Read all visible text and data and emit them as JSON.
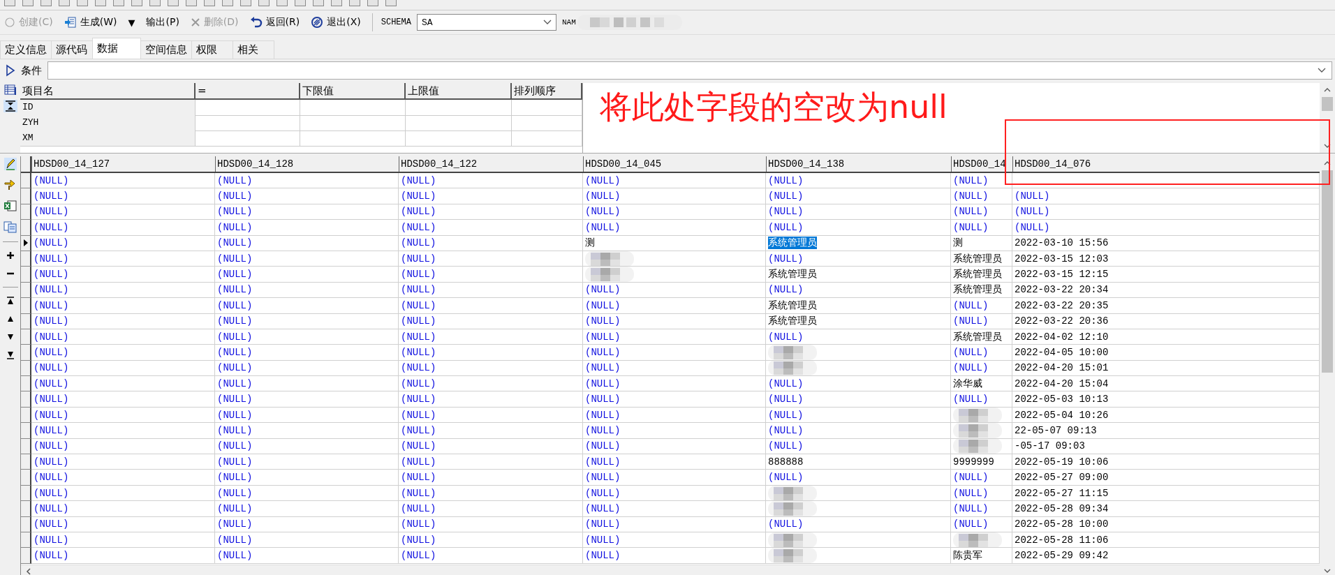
{
  "toolbar": {
    "buttons": [
      {
        "kind": "button",
        "label": "创建(C)",
        "disabled": true
      },
      {
        "kind": "button",
        "label": "生成(W)",
        "disabled": false
      },
      {
        "kind": "glyph",
        "label": "▼"
      },
      {
        "kind": "button",
        "label": "输出(P)",
        "disabled": false
      },
      {
        "kind": "button",
        "label": "删除(D)",
        "disabled": true
      },
      {
        "kind": "button",
        "label": "返回(R)",
        "disabled": false
      },
      {
        "kind": "button",
        "label": "退出(X)",
        "disabled": false
      }
    ]
  },
  "schema": {
    "label": "SCHEMA",
    "value": "SA"
  },
  "name_field": {
    "label": "NAM"
  },
  "tabs": [
    {
      "label": "定义信息",
      "selected": false
    },
    {
      "label": "源代码",
      "selected": false
    },
    {
      "label": "数据",
      "selected": true
    },
    {
      "label": "空间信息",
      "selected": false
    },
    {
      "label": "权限",
      "selected": false
    },
    {
      "label": "相关",
      "selected": false
    }
  ],
  "condition": {
    "label": "条件"
  },
  "filter": {
    "columns": [
      "项目名",
      "=",
      "下限值",
      "上限值",
      "排列顺序"
    ],
    "rows": [
      "ID",
      "ZYH",
      "XM"
    ]
  },
  "annotation": {
    "text": "将此处字段的空改为null"
  },
  "grid": {
    "columns": [
      "HDSD00_14_127",
      "HDSD00_14_128",
      "HDSD00_14_122",
      "HDSD00_14_045",
      "HDSD00_14_138",
      "HDSD00_14",
      "HDSD00_14_076"
    ],
    "rows": [
      {
        "current": false,
        "cells": [
          {
            "kind": "null",
            "value": "(NULL)"
          },
          {
            "kind": "null",
            "value": "(NULL)"
          },
          {
            "kind": "null",
            "value": "(NULL)"
          },
          {
            "kind": "null",
            "value": "(NULL)"
          },
          {
            "kind": "null",
            "value": "(NULL)"
          },
          {
            "kind": "null",
            "value": "(NULL)"
          },
          {
            "kind": "empty"
          }
        ]
      },
      {
        "current": false,
        "cells": [
          {
            "kind": "null",
            "value": "(NULL)"
          },
          {
            "kind": "null",
            "value": "(NULL)"
          },
          {
            "kind": "null",
            "value": "(NULL)"
          },
          {
            "kind": "null",
            "value": "(NULL)"
          },
          {
            "kind": "null",
            "value": "(NULL)"
          },
          {
            "kind": "null",
            "value": "(NULL)"
          },
          {
            "kind": "null",
            "value": "(NULL)"
          }
        ]
      },
      {
        "current": false,
        "cells": [
          {
            "kind": "null",
            "value": "(NULL)"
          },
          {
            "kind": "null",
            "value": "(NULL)"
          },
          {
            "kind": "null",
            "value": "(NULL)"
          },
          {
            "kind": "null",
            "value": "(NULL)"
          },
          {
            "kind": "null",
            "value": "(NULL)"
          },
          {
            "kind": "null",
            "value": "(NULL)"
          },
          {
            "kind": "null",
            "value": "(NULL)"
          }
        ]
      },
      {
        "current": false,
        "cells": [
          {
            "kind": "null",
            "value": "(NULL)"
          },
          {
            "kind": "null",
            "value": "(NULL)"
          },
          {
            "kind": "null",
            "value": "(NULL)"
          },
          {
            "kind": "null",
            "value": "(NULL)"
          },
          {
            "kind": "null",
            "value": "(NULL)"
          },
          {
            "kind": "null",
            "value": "(NULL)"
          },
          {
            "kind": "null",
            "value": "(NULL)"
          }
        ]
      },
      {
        "current": true,
        "cells": [
          {
            "kind": "null",
            "value": "(NULL)"
          },
          {
            "kind": "null",
            "value": "(NULL)"
          },
          {
            "kind": "null",
            "value": "(NULL)"
          },
          {
            "kind": "text",
            "value": "测"
          },
          {
            "kind": "highlighted",
            "value": "系统管理员"
          },
          {
            "kind": "text",
            "value": "测"
          },
          {
            "kind": "text",
            "value": "2022-03-10 15:56"
          }
        ]
      },
      {
        "current": false,
        "cells": [
          {
            "kind": "null",
            "value": "(NULL)"
          },
          {
            "kind": "null",
            "value": "(NULL)"
          },
          {
            "kind": "null",
            "value": "(NULL)"
          },
          {
            "kind": "redacted"
          },
          {
            "kind": "null",
            "value": "(NULL)"
          },
          {
            "kind": "text",
            "value": "系统管理员"
          },
          {
            "kind": "text",
            "value": "2022-03-15 12:03"
          }
        ]
      },
      {
        "current": false,
        "cells": [
          {
            "kind": "null",
            "value": "(NULL)"
          },
          {
            "kind": "null",
            "value": "(NULL)"
          },
          {
            "kind": "null",
            "value": "(NULL)"
          },
          {
            "kind": "redacted"
          },
          {
            "kind": "text",
            "value": "系统管理员"
          },
          {
            "kind": "text",
            "value": "系统管理员"
          },
          {
            "kind": "text",
            "value": "2022-03-15 12:15"
          }
        ]
      },
      {
        "current": false,
        "cells": [
          {
            "kind": "null",
            "value": "(NULL)"
          },
          {
            "kind": "null",
            "value": "(NULL)"
          },
          {
            "kind": "null",
            "value": "(NULL)"
          },
          {
            "kind": "null",
            "value": "(NULL)"
          },
          {
            "kind": "null",
            "value": "(NULL)"
          },
          {
            "kind": "text",
            "value": "系统管理员"
          },
          {
            "kind": "text",
            "value": "2022-03-22 20:34"
          }
        ]
      },
      {
        "current": false,
        "cells": [
          {
            "kind": "null",
            "value": "(NULL)"
          },
          {
            "kind": "null",
            "value": "(NULL)"
          },
          {
            "kind": "null",
            "value": "(NULL)"
          },
          {
            "kind": "null",
            "value": "(NULL)"
          },
          {
            "kind": "text",
            "value": "系统管理员"
          },
          {
            "kind": "null",
            "value": "(NULL)"
          },
          {
            "kind": "text",
            "value": "2022-03-22 20:35"
          }
        ]
      },
      {
        "current": false,
        "cells": [
          {
            "kind": "null",
            "value": "(NULL)"
          },
          {
            "kind": "null",
            "value": "(NULL)"
          },
          {
            "kind": "null",
            "value": "(NULL)"
          },
          {
            "kind": "null",
            "value": "(NULL)"
          },
          {
            "kind": "text",
            "value": "系统管理员"
          },
          {
            "kind": "null",
            "value": "(NULL)"
          },
          {
            "kind": "text",
            "value": "2022-03-22 20:36"
          }
        ]
      },
      {
        "current": false,
        "cells": [
          {
            "kind": "null",
            "value": "(NULL)"
          },
          {
            "kind": "null",
            "value": "(NULL)"
          },
          {
            "kind": "null",
            "value": "(NULL)"
          },
          {
            "kind": "null",
            "value": "(NULL)"
          },
          {
            "kind": "null",
            "value": "(NULL)"
          },
          {
            "kind": "text",
            "value": "系统管理员"
          },
          {
            "kind": "text",
            "value": "2022-04-02 12:10"
          }
        ]
      },
      {
        "current": false,
        "cells": [
          {
            "kind": "null",
            "value": "(NULL)"
          },
          {
            "kind": "null",
            "value": "(NULL)"
          },
          {
            "kind": "null",
            "value": "(NULL)"
          },
          {
            "kind": "null",
            "value": "(NULL)"
          },
          {
            "kind": "redacted"
          },
          {
            "kind": "null",
            "value": "(NULL)"
          },
          {
            "kind": "text",
            "value": "2022-04-05 10:00"
          }
        ]
      },
      {
        "current": false,
        "cells": [
          {
            "kind": "null",
            "value": "(NULL)"
          },
          {
            "kind": "null",
            "value": "(NULL)"
          },
          {
            "kind": "null",
            "value": "(NULL)"
          },
          {
            "kind": "null",
            "value": "(NULL)"
          },
          {
            "kind": "redacted"
          },
          {
            "kind": "null",
            "value": "(NULL)"
          },
          {
            "kind": "text",
            "value": "2022-04-20 15:01"
          }
        ]
      },
      {
        "current": false,
        "cells": [
          {
            "kind": "null",
            "value": "(NULL)"
          },
          {
            "kind": "null",
            "value": "(NULL)"
          },
          {
            "kind": "null",
            "value": "(NULL)"
          },
          {
            "kind": "null",
            "value": "(NULL)"
          },
          {
            "kind": "null",
            "value": "(NULL)"
          },
          {
            "kind": "text",
            "value": "涂华威"
          },
          {
            "kind": "text",
            "value": "2022-04-20 15:04"
          }
        ]
      },
      {
        "current": false,
        "cells": [
          {
            "kind": "null",
            "value": "(NULL)"
          },
          {
            "kind": "null",
            "value": "(NULL)"
          },
          {
            "kind": "null",
            "value": "(NULL)"
          },
          {
            "kind": "null",
            "value": "(NULL)"
          },
          {
            "kind": "null",
            "value": "(NULL)"
          },
          {
            "kind": "null",
            "value": "(NULL)"
          },
          {
            "kind": "text",
            "value": "2022-05-03 10:13"
          }
        ]
      },
      {
        "current": false,
        "cells": [
          {
            "kind": "null",
            "value": "(NULL)"
          },
          {
            "kind": "null",
            "value": "(NULL)"
          },
          {
            "kind": "null",
            "value": "(NULL)"
          },
          {
            "kind": "null",
            "value": "(NULL)"
          },
          {
            "kind": "null",
            "value": "(NULL)"
          },
          {
            "kind": "redacted"
          },
          {
            "kind": "text",
            "value": "2022-05-04 10:26"
          }
        ]
      },
      {
        "current": false,
        "cells": [
          {
            "kind": "null",
            "value": "(NULL)"
          },
          {
            "kind": "null",
            "value": "(NULL)"
          },
          {
            "kind": "null",
            "value": "(NULL)"
          },
          {
            "kind": "null",
            "value": "(NULL)"
          },
          {
            "kind": "null",
            "value": "(NULL)"
          },
          {
            "kind": "redacted"
          },
          {
            "kind": "text",
            "value": "22-05-07 09:13"
          }
        ]
      },
      {
        "current": false,
        "cells": [
          {
            "kind": "null",
            "value": "(NULL)"
          },
          {
            "kind": "null",
            "value": "(NULL)"
          },
          {
            "kind": "null",
            "value": "(NULL)"
          },
          {
            "kind": "null",
            "value": "(NULL)"
          },
          {
            "kind": "null",
            "value": "(NULL)"
          },
          {
            "kind": "redacted"
          },
          {
            "kind": "text",
            "value": "-05-17 09:03"
          }
        ]
      },
      {
        "current": false,
        "cells": [
          {
            "kind": "null",
            "value": "(NULL)"
          },
          {
            "kind": "null",
            "value": "(NULL)"
          },
          {
            "kind": "null",
            "value": "(NULL)"
          },
          {
            "kind": "null",
            "value": "(NULL)"
          },
          {
            "kind": "text",
            "value": "888888"
          },
          {
            "kind": "text",
            "value": "9999999"
          },
          {
            "kind": "text",
            "value": "2022-05-19 10:06"
          }
        ]
      },
      {
        "current": false,
        "cells": [
          {
            "kind": "null",
            "value": "(NULL)"
          },
          {
            "kind": "null",
            "value": "(NULL)"
          },
          {
            "kind": "null",
            "value": "(NULL)"
          },
          {
            "kind": "null",
            "value": "(NULL)"
          },
          {
            "kind": "null",
            "value": "(NULL)"
          },
          {
            "kind": "null",
            "value": "(NULL)"
          },
          {
            "kind": "text",
            "value": "2022-05-27 09:00"
          }
        ]
      },
      {
        "current": false,
        "cells": [
          {
            "kind": "null",
            "value": "(NULL)"
          },
          {
            "kind": "null",
            "value": "(NULL)"
          },
          {
            "kind": "null",
            "value": "(NULL)"
          },
          {
            "kind": "null",
            "value": "(NULL)"
          },
          {
            "kind": "redacted"
          },
          {
            "kind": "null",
            "value": "(NULL)"
          },
          {
            "kind": "text",
            "value": "2022-05-27 11:15"
          }
        ]
      },
      {
        "current": false,
        "cells": [
          {
            "kind": "null",
            "value": "(NULL)"
          },
          {
            "kind": "null",
            "value": "(NULL)"
          },
          {
            "kind": "null",
            "value": "(NULL)"
          },
          {
            "kind": "null",
            "value": "(NULL)"
          },
          {
            "kind": "redacted"
          },
          {
            "kind": "null",
            "value": "(NULL)"
          },
          {
            "kind": "text",
            "value": "2022-05-28 09:34"
          }
        ]
      },
      {
        "current": false,
        "cells": [
          {
            "kind": "null",
            "value": "(NULL)"
          },
          {
            "kind": "null",
            "value": "(NULL)"
          },
          {
            "kind": "null",
            "value": "(NULL)"
          },
          {
            "kind": "null",
            "value": "(NULL)"
          },
          {
            "kind": "null",
            "value": "(NULL)"
          },
          {
            "kind": "null",
            "value": "(NULL)"
          },
          {
            "kind": "text",
            "value": "2022-05-28 10:00"
          }
        ]
      },
      {
        "current": false,
        "cells": [
          {
            "kind": "null",
            "value": "(NULL)"
          },
          {
            "kind": "null",
            "value": "(NULL)"
          },
          {
            "kind": "null",
            "value": "(NULL)"
          },
          {
            "kind": "null",
            "value": "(NULL)"
          },
          {
            "kind": "redacted"
          },
          {
            "kind": "redacted"
          },
          {
            "kind": "text",
            "value": "2022-05-28 11:06"
          }
        ]
      },
      {
        "current": false,
        "cells": [
          {
            "kind": "null",
            "value": "(NULL)"
          },
          {
            "kind": "null",
            "value": "(NULL)"
          },
          {
            "kind": "null",
            "value": "(NULL)"
          },
          {
            "kind": "null",
            "value": "(NULL)"
          },
          {
            "kind": "redacted"
          },
          {
            "kind": "text",
            "value": "陈贵军"
          },
          {
            "kind": "text",
            "value": "2022-05-29 09:42"
          }
        ]
      }
    ]
  }
}
